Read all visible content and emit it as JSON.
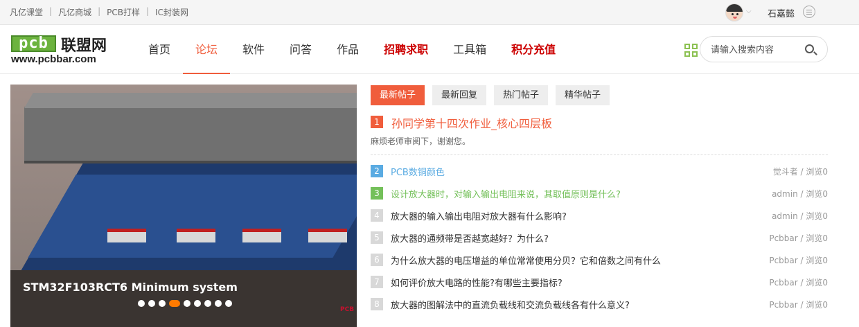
{
  "topbar": {
    "links": [
      "凡亿课堂",
      "凡亿商城",
      "PCB打样",
      "IC封装网"
    ],
    "sep": "|",
    "username": "石嘉懿"
  },
  "header": {
    "logo_box": "pcb",
    "logo_name": "联盟网",
    "logo_url": "www.pcbbar.com",
    "nav": [
      "首页",
      "论坛",
      "软件",
      "问答",
      "作品",
      "招聘求职",
      "工具箱",
      "积分充值"
    ],
    "active_nav": "论坛",
    "search_placeholder": "请输入搜索内容"
  },
  "slider": {
    "caption": "STM32F103RCT6 Minimum system",
    "slide_count": 9,
    "active_slide": 4,
    "watermark": "PCB"
  },
  "tabs": [
    "最新帖子",
    "最新回复",
    "热门帖子",
    "精华帖子"
  ],
  "featured": {
    "num": "1",
    "title": "孙同学第十四次作业_核心四层板",
    "desc": "麻烦老师审阅下，谢谢您。"
  },
  "posts": [
    {
      "num": "2",
      "title": "PCB数铜颜色",
      "meta": "觉斗者 / 浏览0"
    },
    {
      "num": "3",
      "title": "设计放大器时，对输入输出电阻来说，其取值原则是什么?",
      "meta": "admin / 浏览0"
    },
    {
      "num": "4",
      "title": "放大器的输入输出电阻对放大器有什么影响?",
      "meta": "admin / 浏览0"
    },
    {
      "num": "5",
      "title": "放大器的通频带是否越宽越好？为什么?",
      "meta": "Pcbbar / 浏览0"
    },
    {
      "num": "6",
      "title": "为什么放大器的电压增益的单位常常使用分贝？它和倍数之间有什么",
      "meta": "Pcbbar / 浏览0"
    },
    {
      "num": "7",
      "title": "如何评价放大电路的性能?有哪些主要指标?",
      "meta": "Pcbbar / 浏览0"
    },
    {
      "num": "8",
      "title": "放大器的图解法中的直流负载线和交流负载线各有什么意义?",
      "meta": "Pcbbar / 浏览0"
    }
  ],
  "colors": {
    "accent": "#f05d3c",
    "hot": "#cc0000",
    "blue": "#5aabe2",
    "green": "#74c05a"
  }
}
